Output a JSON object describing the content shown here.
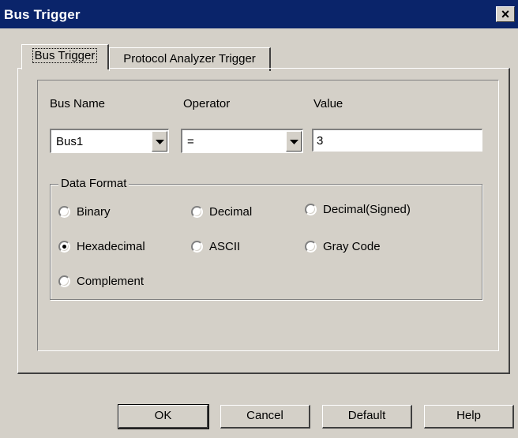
{
  "window": {
    "title": "Bus Trigger",
    "close_glyph": "✕"
  },
  "tabs": [
    {
      "label": "Bus Trigger",
      "active": true
    },
    {
      "label": "Protocol Analyzer Trigger",
      "active": false
    }
  ],
  "fields": {
    "bus_name": {
      "label": "Bus Name",
      "value": "Bus1"
    },
    "operator": {
      "label": "Operator",
      "value": "="
    },
    "value": {
      "label": "Value",
      "value": "3"
    }
  },
  "data_format": {
    "legend": "Data Format",
    "options": [
      {
        "label": "Binary",
        "selected": false
      },
      {
        "label": "Decimal",
        "selected": false
      },
      {
        "label": "Decimal(Signed)",
        "selected": false
      },
      {
        "label": "Hexadecimal",
        "selected": true
      },
      {
        "label": "ASCII",
        "selected": false
      },
      {
        "label": "Gray Code",
        "selected": false
      },
      {
        "label": "Complement",
        "selected": false
      }
    ]
  },
  "buttons": {
    "ok": "OK",
    "cancel": "Cancel",
    "default": "Default",
    "help": "Help"
  },
  "colors": {
    "titlebar": "#0a246a",
    "face": "#d4d0c8"
  }
}
